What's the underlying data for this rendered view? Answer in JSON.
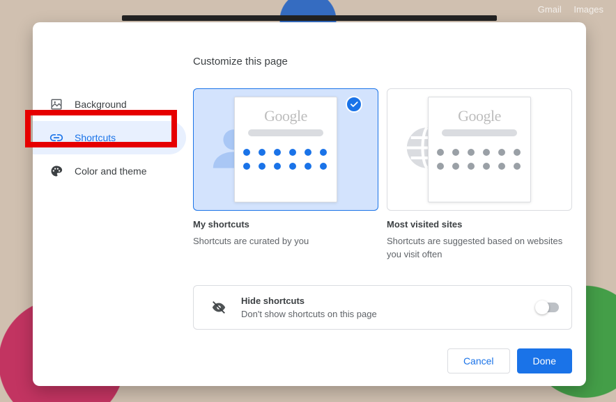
{
  "top_links": {
    "gmail": "Gmail",
    "images": "Images"
  },
  "title": "Customize this page",
  "nav": {
    "background": "Background",
    "shortcuts": "Shortcuts",
    "color_theme": "Color and theme",
    "active": "shortcuts"
  },
  "tiles": {
    "logo_text": "Google"
  },
  "options": {
    "my": {
      "title": "My shortcuts",
      "desc": "Shortcuts are curated by you",
      "selected": true
    },
    "most": {
      "title": "Most visited sites",
      "desc": "Shortcuts are suggested based on websites you visit often",
      "selected": false
    }
  },
  "hide": {
    "title": "Hide shortcuts",
    "desc": "Don't show shortcuts on this page",
    "enabled": false
  },
  "buttons": {
    "cancel": "Cancel",
    "done": "Done"
  }
}
